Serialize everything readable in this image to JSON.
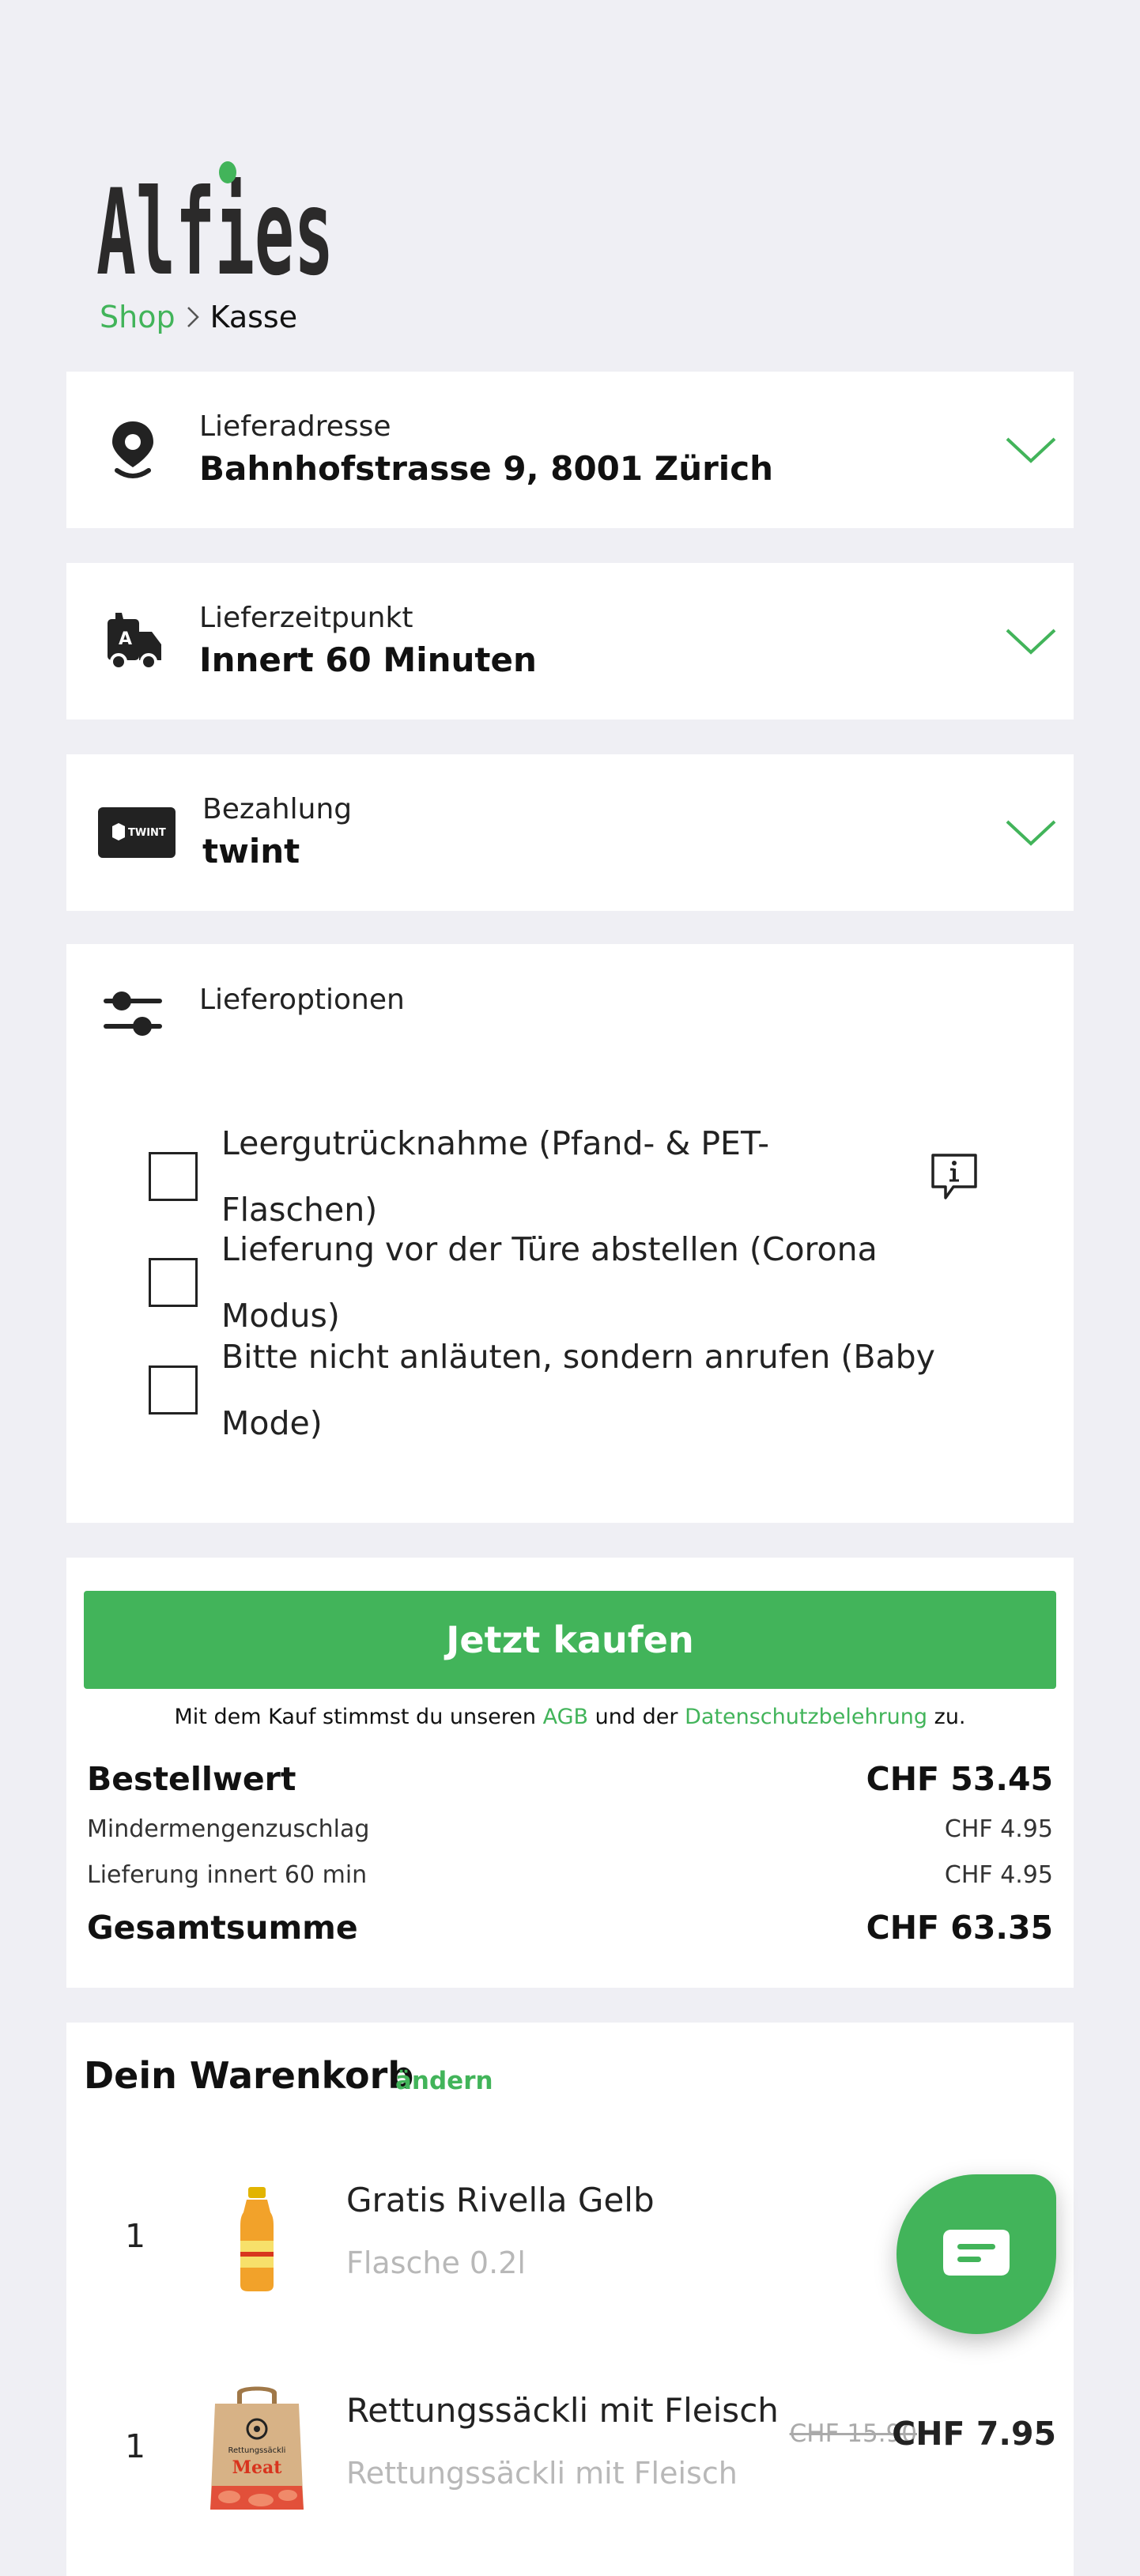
{
  "brand": {
    "logo_text": "Alfies",
    "accent": "#42b45a",
    "dark": "#2b2a2a"
  },
  "breadcrumb": {
    "shop": "Shop",
    "current": "Kasse"
  },
  "address": {
    "label": "Lieferadresse",
    "value": "Bahnhofstrasse 9, 8001 Zürich",
    "icon": "location-pin-icon"
  },
  "delivery_time": {
    "label": "Lieferzeitpunkt",
    "value": "Innert 60 Minuten",
    "icon": "delivery-van-icon"
  },
  "payment": {
    "label": "Bezahlung",
    "value": "twint",
    "badge": "TWINT"
  },
  "options": {
    "title": "Lieferoptionen",
    "items": [
      {
        "label": "Leergutrücknahme (Pfand- & PET-Flaschen)",
        "checked": false
      },
      {
        "label": "Lieferung vor der Türe abstellen (Corona Modus)",
        "checked": false
      },
      {
        "label": "Bitte nicht anläuten, sondern anrufen (Baby Mode)",
        "checked": false
      }
    ]
  },
  "checkout": {
    "button": "Jetzt kaufen",
    "terms_prefix": "Mit dem Kauf stimmst du unseren",
    "terms_agb": "AGB",
    "terms_middle": "und der",
    "terms_privacy": "Datenschutzbelehrung",
    "terms_suffix": "zu.",
    "order_value_label": "Bestellwert",
    "order_value": "CHF 53.45",
    "surcharge_label": "Mindermengenzuschlag",
    "surcharge": "CHF 4.95",
    "delivery_label": "Lieferung innert 60 min",
    "delivery_fee": "CHF 4.95",
    "total_label": "Gesamtsumme",
    "total": "CHF 63.35"
  },
  "cart": {
    "title": "Dein Warenkorb",
    "edit": "ändern",
    "items": [
      {
        "qty": "1",
        "name": "Gratis Rivella Gelb",
        "sub": "Flasche 0.2l",
        "old_price": "",
        "price": ""
      },
      {
        "qty": "1",
        "name": "Rettungssäckli mit Fleisch",
        "sub": "Rettungssäckli mit Fleisch",
        "old_price": "CHF 15.90",
        "price": "CHF 7.95",
        "bag_brand": "Rettungssäckli",
        "bag_word": "Meat"
      }
    ]
  }
}
